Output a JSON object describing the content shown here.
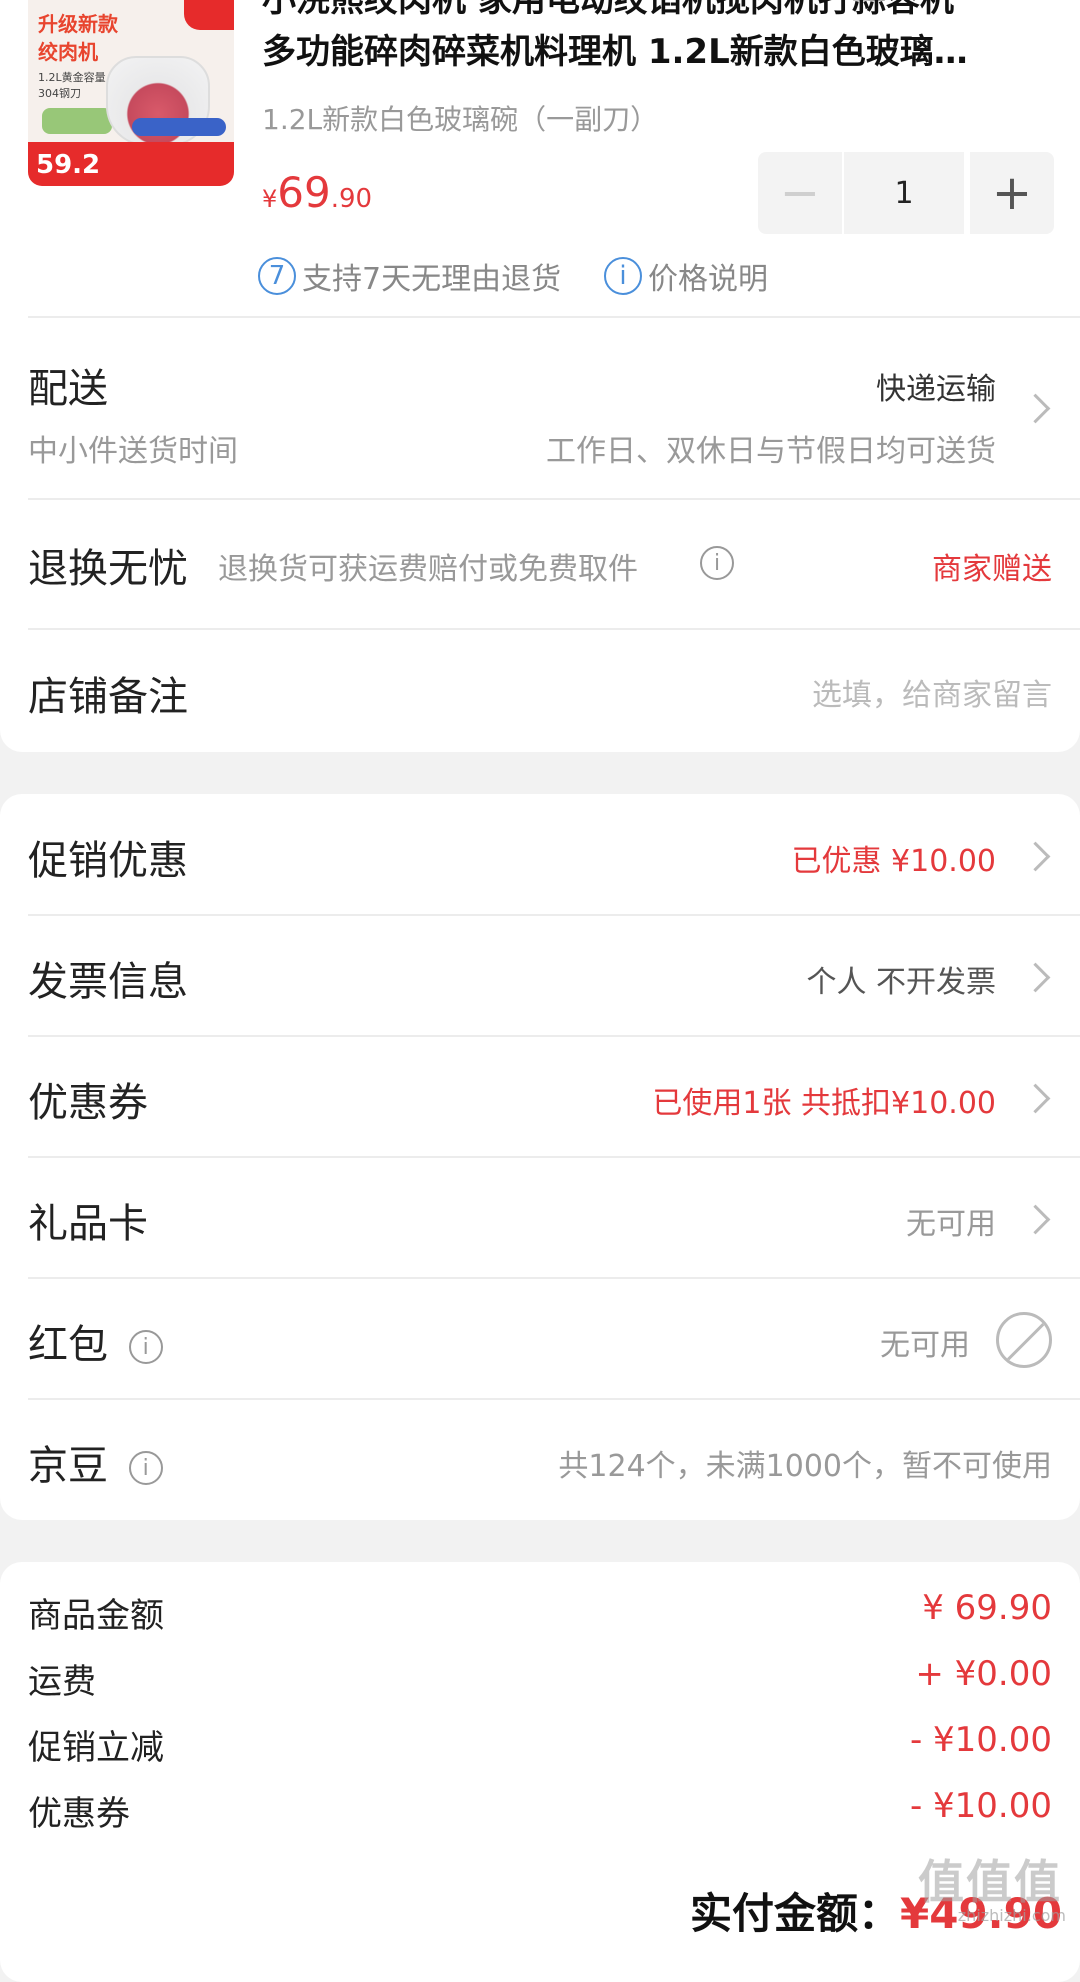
{
  "product": {
    "thumb_title": "升级新款\n绞肉机",
    "thumb_specs": "1.2L黄金容量\n304钢刀",
    "thumb_price": "59.2",
    "title_line1": "小浣熊绞肉机 家用电动绞馅机搅肉机打蒜蓉机",
    "title_line2": "多功能碎肉碎菜机料理机 1.2L新款白色玻璃…",
    "variant": "1.2L新款白色玻璃碗（一副刀）",
    "price_symbol": "¥",
    "price_int": "69",
    "price_dec": ".90",
    "quantity": "1",
    "minus_label": "−",
    "plus_label": "+",
    "service_icon": "7",
    "service_text": "支持7天无理由退货",
    "price_info_icon": "i",
    "price_info_text": "价格说明"
  },
  "delivery": {
    "label": "配送",
    "method": "快递运输",
    "sub_label": "中小件送货时间",
    "sub_value": "工作日、双休日与节假日均可送货"
  },
  "returns": {
    "label": "退换无忧",
    "desc": "退换货可获运费赔付或免费取件",
    "value": "商家赠送"
  },
  "note": {
    "label": "店铺备注",
    "placeholder": "选填，给商家留言"
  },
  "options": {
    "promo": {
      "label": "促销优惠",
      "value": "已优惠 ¥10.00"
    },
    "invoice": {
      "label": "发票信息",
      "value": "个人 不开发票"
    },
    "coupon": {
      "label": "优惠券",
      "value": "已使用1张 共抵扣¥10.00"
    },
    "giftcard": {
      "label": "礼品卡",
      "value": "无可用"
    },
    "redpacket": {
      "label": "红包",
      "value": "无可用"
    },
    "jingdou": {
      "label": "京豆",
      "value": "共124个，未满1000个，暂不可使用"
    }
  },
  "summary": [
    {
      "label": "商品金额",
      "value": "¥ 69.90"
    },
    {
      "label": "运费",
      "value": "+ ¥0.00"
    },
    {
      "label": "促销立减",
      "value": "- ¥10.00"
    },
    {
      "label": "优惠券",
      "value": "- ¥10.00"
    }
  ],
  "total": {
    "label": "实付金额：",
    "value": "¥49.90"
  },
  "watermark": {
    "logo": "值值值",
    "url": "zhizhizhi.com"
  },
  "colors": {
    "accent_red": "#e4393c",
    "info_blue": "#4a8fdb",
    "background": "#f2f2f2"
  }
}
